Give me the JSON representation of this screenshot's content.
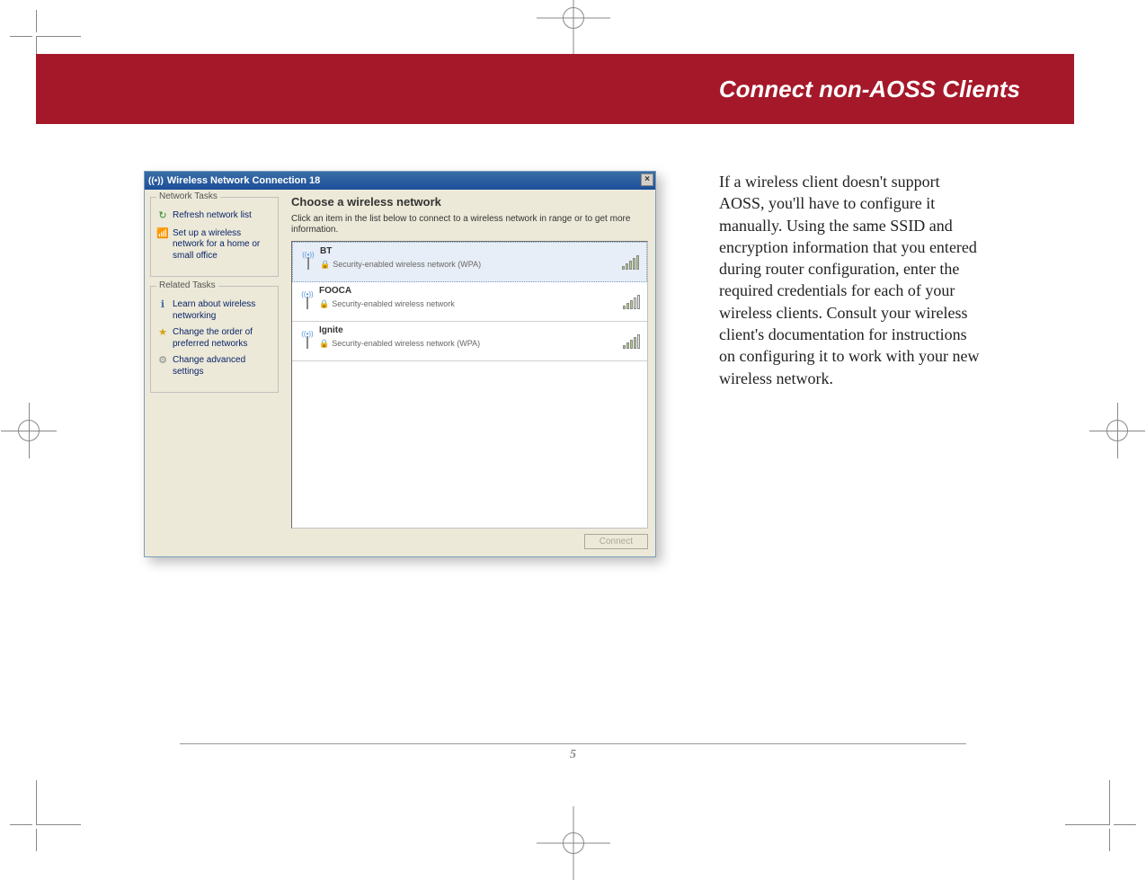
{
  "header": {
    "title": "Connect non-AOSS Clients"
  },
  "body_text": "If a wireless client doesn't support AOSS, you'll have to configure it manually. Using the same SSID and encryption information that you entered during router configuration, enter the required credentials for each of your wireless clients. Consult your wireless client's documentation for instructions on configuring it to work with your new wireless network.",
  "page_number": "5",
  "window": {
    "title": "Wireless Network Connection 18",
    "left_panel": {
      "network_tasks_title": "Network Tasks",
      "network_tasks": [
        {
          "icon": "↻",
          "label": "Refresh network list"
        },
        {
          "icon": "📶",
          "label": "Set up a wireless network for a home or small office"
        }
      ],
      "related_tasks_title": "Related Tasks",
      "related_tasks": [
        {
          "icon": "ℹ",
          "label": "Learn about wireless networking"
        },
        {
          "icon": "★",
          "label": "Change the order of preferred networks"
        },
        {
          "icon": "⚙",
          "label": "Change advanced settings"
        }
      ]
    },
    "right_panel": {
      "title": "Choose a wireless network",
      "description": "Click an item in the list below to connect to a wireless network in range or to get more information.",
      "networks": [
        {
          "name": "BT",
          "security": "Security-enabled wireless network (WPA)",
          "signal": 5
        },
        {
          "name": "FOOCA",
          "security": "Security-enabled wireless network",
          "signal": 3
        },
        {
          "name": "Ignite",
          "security": "Security-enabled wireless network (WPA)",
          "signal": 4
        }
      ],
      "connect_label": "Connect"
    }
  }
}
